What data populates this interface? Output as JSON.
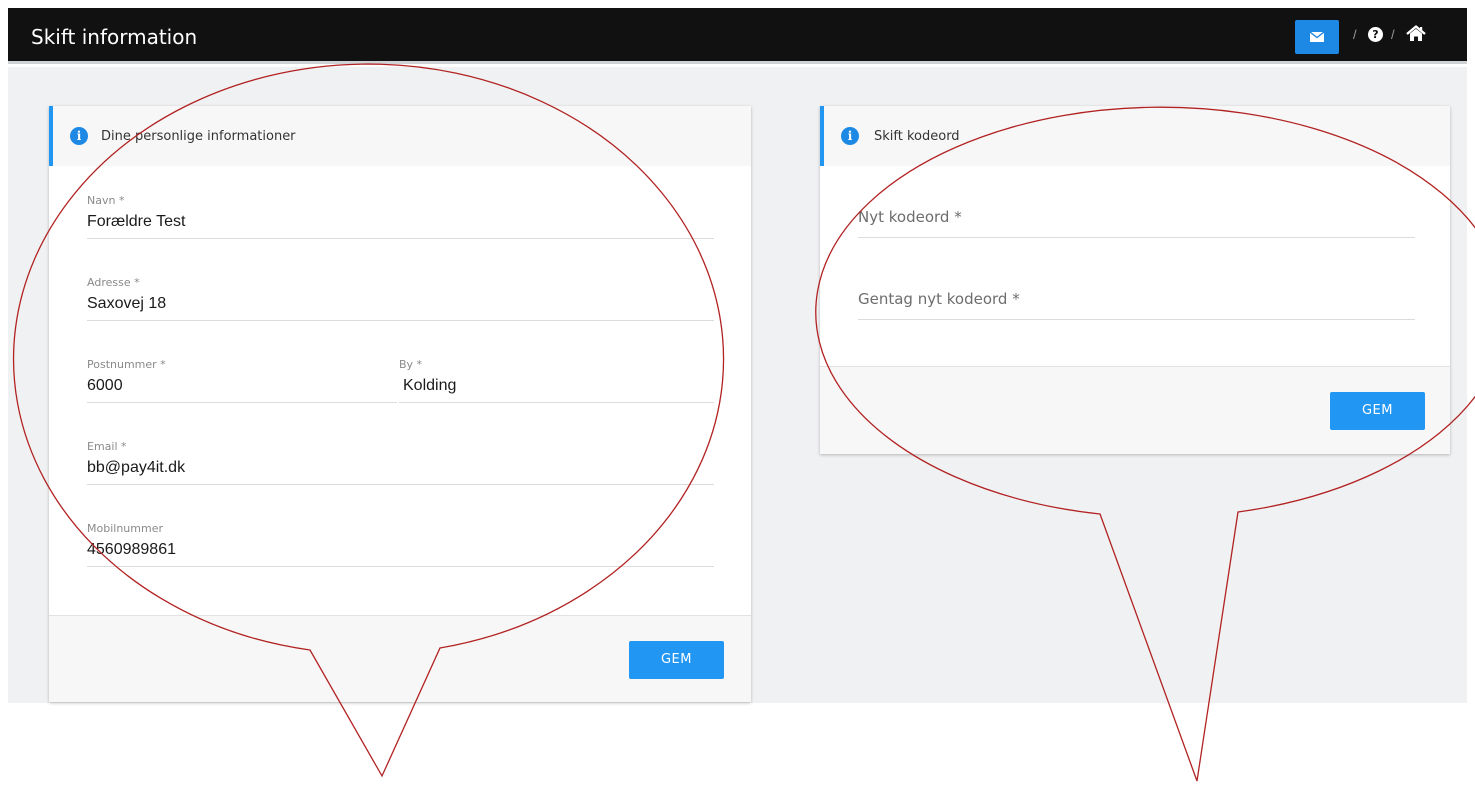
{
  "header": {
    "title": "Skift information",
    "separator": "/",
    "help_glyph": "?",
    "mail_icon": "envelope-icon",
    "help_icon": "question-circle-icon",
    "home_icon": "home-icon",
    "accent_color": "#1e88e5"
  },
  "personal": {
    "title": "Dine personlige informationer",
    "info_glyph": "i",
    "fields": {
      "name": {
        "label": "Navn *",
        "value": "Forældre Test"
      },
      "address": {
        "label": "Adresse *",
        "value": "Saxovej 18"
      },
      "postal": {
        "label": "Postnummer *",
        "value": "6000"
      },
      "city": {
        "label": "By *",
        "value": "Kolding"
      },
      "email": {
        "label": "Email *",
        "value": "bb@pay4it.dk"
      },
      "mobile": {
        "label": "Mobilnummer",
        "value": "4560989861"
      }
    },
    "save_label": "GEM"
  },
  "password": {
    "title": "Skift kodeord",
    "info_glyph": "i",
    "new_placeholder": "Nyt kodeord *",
    "repeat_placeholder": "Gentag nyt kodeord *",
    "save_label": "GEM"
  },
  "annotations": {
    "type": "speech-bubble",
    "count": 2,
    "stroke_color": "#b22222"
  }
}
